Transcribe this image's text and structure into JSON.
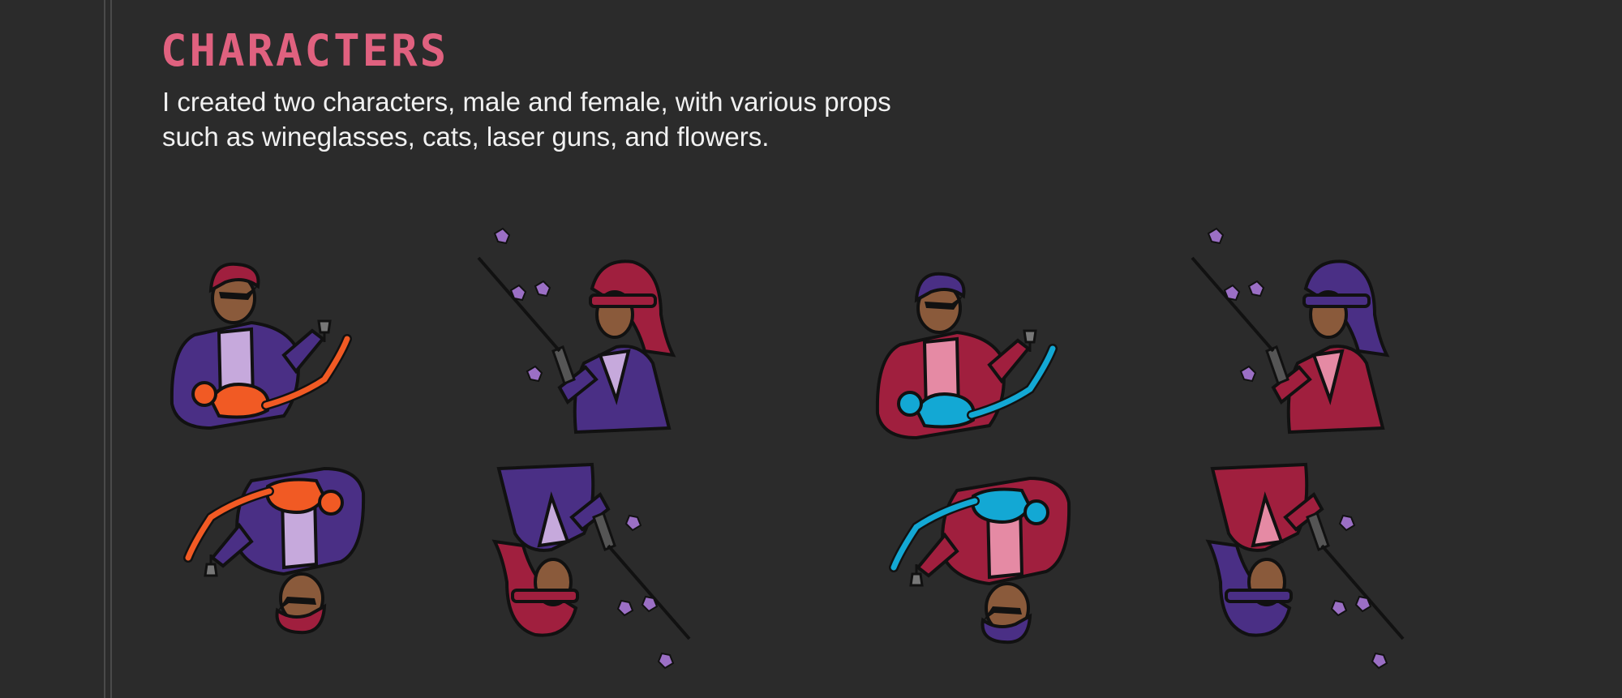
{
  "heading": "CHARACTERS",
  "description": "I created two characters, male and female, with various props such as wineglasses, cats, laser guns, and flowers.",
  "palette": {
    "background": "#2b2b2b",
    "accent": "#e0617f",
    "text": "#f1f1f1",
    "outline": "#111111",
    "skin": "#8a5a3b",
    "purple_suit": "#4a2f85",
    "red_suit": "#a01f3e",
    "lavender": "#c6a9dc",
    "pink": "#e58aa4",
    "orange_cat": "#f15a24",
    "cyan_cat": "#13a8d4",
    "petal": "#9b6fc5"
  },
  "cards": [
    {
      "character": "male",
      "suit": "purple_suit",
      "hair": "red_suit",
      "shirt": "lavender",
      "prop": "cat",
      "prop_color": "orange_cat",
      "prop_icon": "wineglass-icon"
    },
    {
      "character": "female",
      "suit": "purple_suit",
      "hair": "red_suit",
      "shirt": "lavender",
      "prop": "laser-gun",
      "prop_color": "petal",
      "prop_icon": "flower-icon"
    },
    {
      "character": "male",
      "suit": "red_suit",
      "hair": "purple_suit",
      "shirt": "pink",
      "prop": "cat",
      "prop_color": "cyan_cat",
      "prop_icon": "wineglass-icon"
    },
    {
      "character": "female",
      "suit": "red_suit",
      "hair": "purple_suit",
      "shirt": "pink",
      "prop": "laser-gun",
      "prop_color": "petal",
      "prop_icon": "flower-icon"
    }
  ]
}
